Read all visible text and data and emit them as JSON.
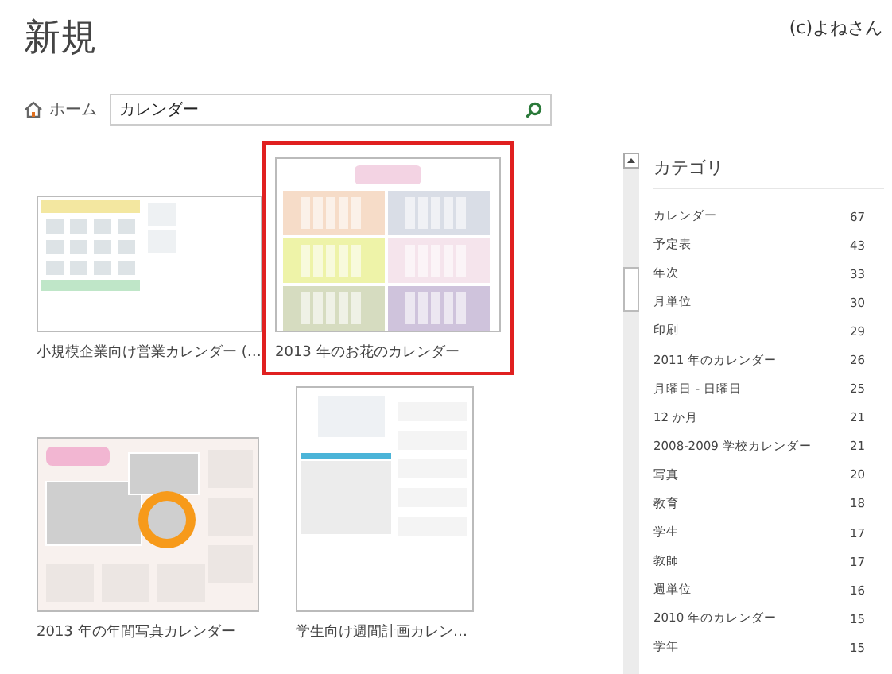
{
  "header": {
    "title": "新規",
    "credit": "(c)よねさん"
  },
  "nav": {
    "home": "ホーム"
  },
  "search": {
    "value": "カレンダー"
  },
  "templates": [
    {
      "title": "小規模企業向け営業カレンダー (…",
      "kind": "business",
      "selected": false
    },
    {
      "title": "2013 年のお花のカレンダー",
      "kind": "flower",
      "selected": true
    },
    {
      "title": "2013 年の年間写真カレンダー",
      "kind": "photo",
      "selected": false
    },
    {
      "title": "学生向け週間計画カレン…",
      "kind": "weekly",
      "selected": false
    }
  ],
  "categories": {
    "heading": "カテゴリ",
    "items": [
      {
        "name": "カレンダー",
        "count": "67"
      },
      {
        "name": "予定表",
        "count": "43"
      },
      {
        "name": "年次",
        "count": "33"
      },
      {
        "name": "月単位",
        "count": "30"
      },
      {
        "name": "印刷",
        "count": "29"
      },
      {
        "name": "2011 年のカレンダー",
        "count": "26"
      },
      {
        "name": "月曜日 - 日曜日",
        "count": "25"
      },
      {
        "name": "12 か月",
        "count": "21"
      },
      {
        "name": "2008-2009 学校カレンダー",
        "count": "21"
      },
      {
        "name": "写真",
        "count": "20"
      },
      {
        "name": "教育",
        "count": "18"
      },
      {
        "name": "学生",
        "count": "17"
      },
      {
        "name": "教師",
        "count": "17"
      },
      {
        "name": "週単位",
        "count": "16"
      },
      {
        "name": "2010 年のカレンダー",
        "count": "15"
      },
      {
        "name": "学年",
        "count": "15"
      }
    ]
  }
}
